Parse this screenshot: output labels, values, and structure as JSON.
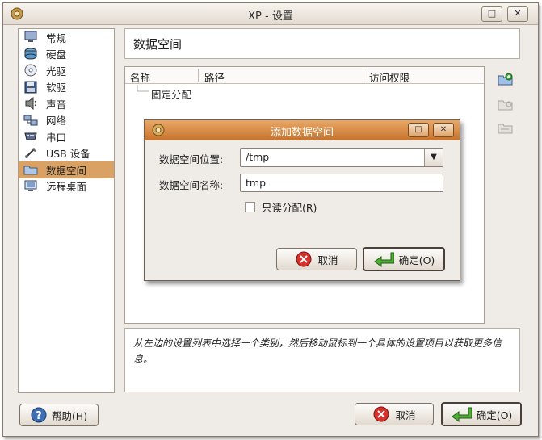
{
  "window": {
    "title": "XP - 设置"
  },
  "sidebar": {
    "items": [
      {
        "label": "常规",
        "icon": "monitor-icon"
      },
      {
        "label": "硬盘",
        "icon": "hard-disk-icon"
      },
      {
        "label": "光驱",
        "icon": "cd-rom-icon"
      },
      {
        "label": "软驱",
        "icon": "floppy-icon"
      },
      {
        "label": "声音",
        "icon": "speaker-icon"
      },
      {
        "label": "网络",
        "icon": "network-icon"
      },
      {
        "label": "串口",
        "icon": "serial-port-icon"
      },
      {
        "label": "USB 设备",
        "icon": "usb-icon"
      },
      {
        "label": "数据空间",
        "icon": "shared-folder-icon",
        "selected": true
      },
      {
        "label": "远程桌面",
        "icon": "remote-desktop-icon"
      }
    ]
  },
  "main": {
    "header": "数据空间",
    "columns": [
      "名称",
      "路径",
      "访问权限"
    ],
    "tree_rows": [
      "固定分配"
    ]
  },
  "info_text": "从左边的设置列表中选择一个类别，然后移动鼠标到一个具体的设置项目以获取更多信息。",
  "buttons": {
    "help": "帮助(H)",
    "cancel": "取消",
    "ok": "确定(O)"
  },
  "dialog": {
    "title": "添加数据空间",
    "path_label": "数据空间位置:",
    "path_value": "/tmp",
    "name_label": "数据空间名称:",
    "name_value": "tmp",
    "readonly_label": "只读分配(R)",
    "cancel": "取消",
    "ok": "确定(O)"
  }
}
